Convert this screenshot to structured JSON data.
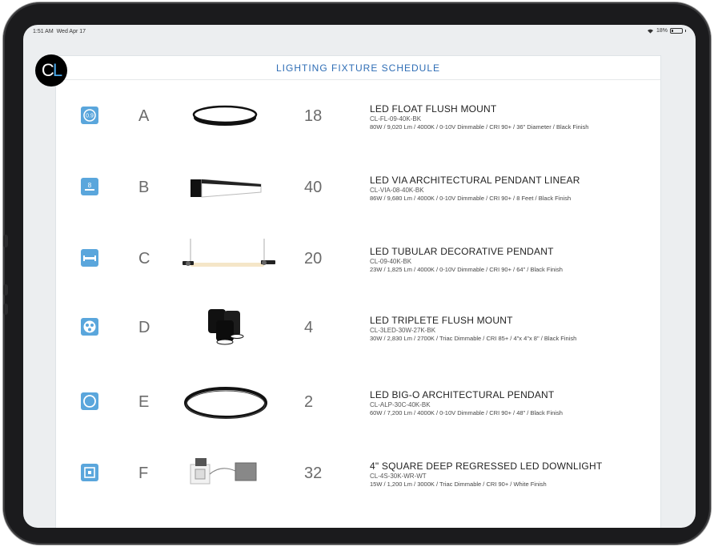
{
  "status": {
    "time": "1:51 AM",
    "date": "Wed Apr 17",
    "battery": "18%",
    "battery_level": 0.18
  },
  "logo": {
    "letters_c": "C",
    "letters_l": "L"
  },
  "schedule": {
    "title": "LIGHTING FIXTURE SCHEDULE",
    "rows": [
      {
        "badge": "0.9",
        "type": "A",
        "qty": "18",
        "name": "LED FLOAT FLUSH MOUNT",
        "code": "CL-FL-09-40K-BK",
        "spec": "80W / 9,020 Lm / 4000K / 0-10V Dimmable  / CRI 90+ / 36\" Diameter / Black Finish",
        "icon": "flush-mount-disc"
      },
      {
        "badge": "8",
        "type": "B",
        "qty": "40",
        "name": "LED VIA ARCHITECTURAL PENDANT LINEAR",
        "code": "CL-VIA-08-40K-BK",
        "spec": "86W / 9,680 Lm / 4000K / 0-10V Dimmable  / CRI 90+ / 8 Feet / Black Finish",
        "icon": "linear-pendant"
      },
      {
        "badge": "",
        "type": "C",
        "qty": "20",
        "name": "LED TUBULAR DECORATIVE PENDANT",
        "code": "CL-09-40K-BK",
        "spec": "23W / 1,825 Lm / 4000K / 0-10V Dimmable  / CRI 90+ / 64\" / Black Finish",
        "icon": "tubular-pendant"
      },
      {
        "badge": "",
        "type": "D",
        "qty": "4",
        "name": "LED TRIPLETE FLUSH MOUNT",
        "code": "CL-3LED-30W-27K-BK",
        "spec": "30W / 2,830 Lm / 2700K / Triac Dimmable  / CRI 85+ / 4\"x 4\"x 8\"  / Black Finish",
        "icon": "triple-cylinder"
      },
      {
        "badge": "",
        "type": "E",
        "qty": "2",
        "name": "LED BIG-O ARCHITECTURAL PENDANT",
        "code": "CL-ALP-30C-40K-BK",
        "spec": "60W / 7,200 Lm / 4000K / 0-10V Dimmable  / CRI 90+ / 48\" / Black Finish",
        "icon": "ring-pendant"
      },
      {
        "badge": "",
        "type": "F",
        "qty": "32",
        "name": "4\" SQUARE DEEP REGRESSED LED DOWNLIGHT",
        "code": "CL-4S-30K-WR-WT",
        "spec": "15W / 1,200 Lm / 3000K / Triac Dimmable  / CRI 90+ / White Finish",
        "icon": "square-downlight"
      }
    ]
  }
}
